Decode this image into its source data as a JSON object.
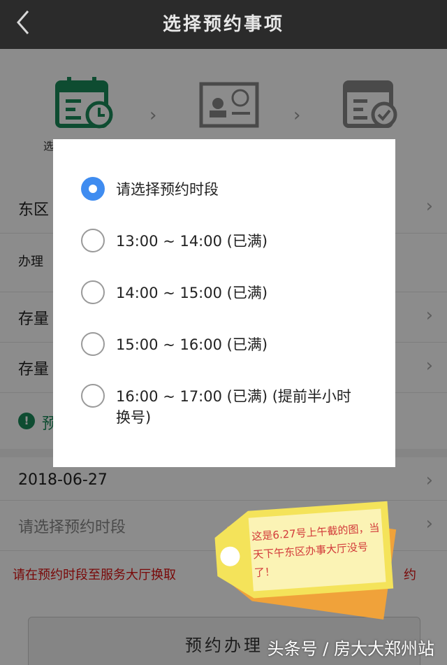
{
  "header": {
    "back_icon": "chevron-left-icon",
    "title": "选择预约事项"
  },
  "steps": [
    {
      "icon": "calendar-clock-icon",
      "label": "选",
      "active": true
    },
    {
      "icon": "id-card-icon",
      "label": "",
      "active": false
    },
    {
      "icon": "calendar-check-icon",
      "label": "",
      "active": false
    }
  ],
  "rows": {
    "district": "东区",
    "process": "办理",
    "stock1": "存量",
    "stock2": "存量",
    "notice_prefix": "预",
    "date": "2018-06-27",
    "time_placeholder": "请选择预约时段"
  },
  "red_note": {
    "text": "请在预约时段至服务大厅换取",
    "tail": "约"
  },
  "submit": {
    "label": "预约办理"
  },
  "dialog": {
    "options": [
      {
        "label": "请选择预约时段",
        "checked": true
      },
      {
        "label": "13:00 ~ 14:00 (已满)",
        "checked": false
      },
      {
        "label": "14:00 ~ 15:00 (已满)",
        "checked": false
      },
      {
        "label": "15:00 ~ 16:00 (已满)",
        "checked": false
      },
      {
        "label": "16:00 ~ 17:00 (已满) (提前半小时换号)",
        "checked": false
      }
    ]
  },
  "tag_note": "这是6.27号上午截的图，当天下午东区办事大厅没号了！",
  "watermark": "头条号 / 房大大郑州站",
  "colors": {
    "accent_green": "#1b8a5a",
    "radio_blue": "#3f8cf0",
    "red": "#dd1111",
    "tag_yellow": "#f4e35a",
    "tag_orange": "#f0a23a"
  }
}
